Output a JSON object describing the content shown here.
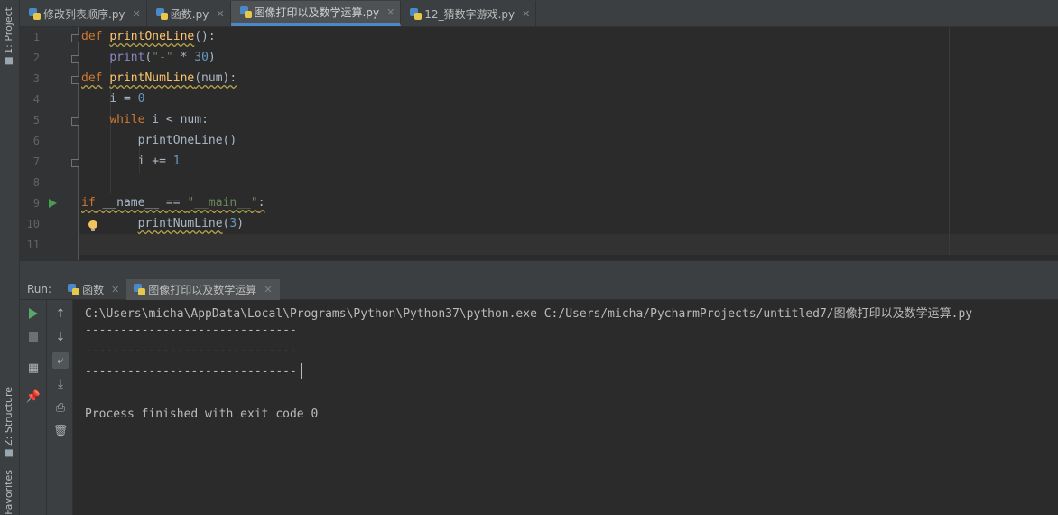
{
  "left_strip": {
    "project_label": "1: Project",
    "structure_label": "Z: Structure",
    "favorites_label": "Favorites"
  },
  "editor_tabs": [
    {
      "label": "修改列表顺序.py",
      "active": false
    },
    {
      "label": "函数.py",
      "active": false
    },
    {
      "label": "图像打印以及数学运算.py",
      "active": true
    },
    {
      "label": "12_猜数字游戏.py",
      "active": false
    }
  ],
  "editor": {
    "line_numbers": [
      "1",
      "2",
      "3",
      "4",
      "5",
      "6",
      "7",
      "8",
      "9",
      "10",
      "11"
    ],
    "code": {
      "l1_def": "def",
      "l1_name": "printOneLine",
      "l1_rest": "():",
      "l2_print": "print",
      "l2_open": "(",
      "l2_str": "\"-\"",
      "l2_op": " * ",
      "l2_num": "30",
      "l2_close": ")",
      "l3_def": "def",
      "l3_name": "printNumLine",
      "l3_rest": "(num):",
      "l4_var": "i = ",
      "l4_num": "0",
      "l5_while": "while",
      "l5_rest": " i < num:",
      "l6_call": "printOneLine()",
      "l7_var": "i += ",
      "l7_num": "1",
      "l9_if": "if",
      "l9_name": " __name__ == ",
      "l9_str": "\"__main__\"",
      "l9_colon": ":",
      "l10_call": "printNumLine",
      "l10_open": "(",
      "l10_num": "3",
      "l10_close": ")"
    }
  },
  "run_panel": {
    "label": "Run:",
    "tabs": [
      {
        "label": "函数",
        "active": false
      },
      {
        "label": "图像打印以及数学运算",
        "active": true
      }
    ]
  },
  "console": {
    "command": "C:\\Users\\micha\\AppData\\Local\\Programs\\Python\\Python37\\python.exe C:/Users/micha/PycharmProjects/untitled7/图像打印以及数学运算.py",
    "output_lines": [
      "------------------------------",
      "------------------------------",
      "------------------------------"
    ],
    "exit_message": "Process finished with exit code 0"
  },
  "icons": {
    "python_file": "python-file-icon",
    "run": "run-icon",
    "stop": "stop-icon",
    "bulb": "lightbulb-icon"
  }
}
